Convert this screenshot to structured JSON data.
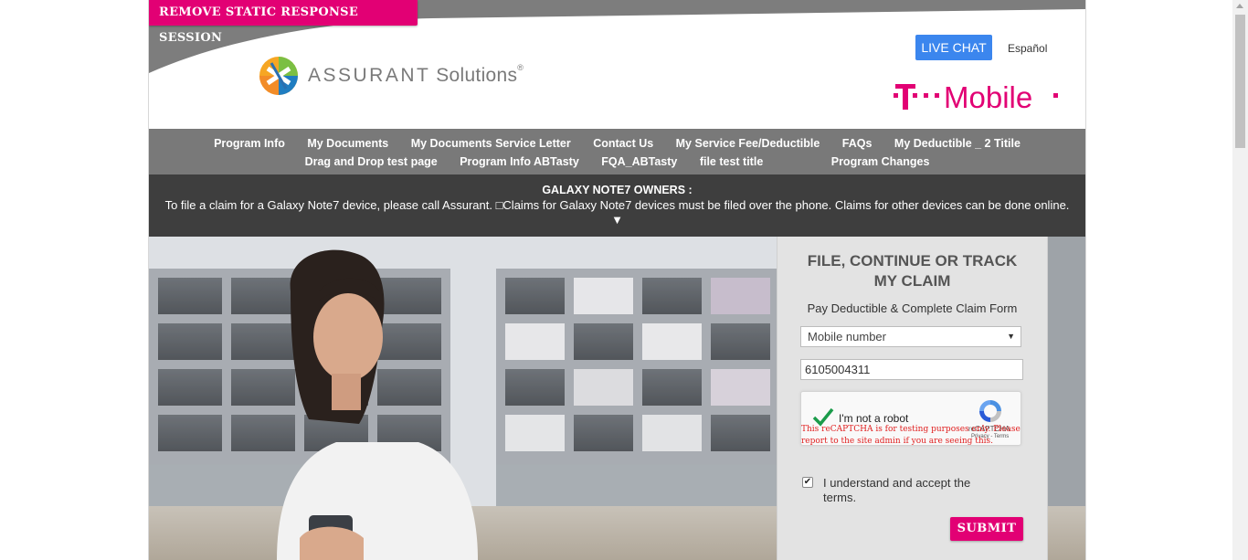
{
  "header": {
    "remove_session_label": "REMOVE STATIC RESPONSE SESSION",
    "logo_brand": "ASSURANT",
    "logo_sub": "Solutions",
    "logo_reg": "®",
    "live_chat_label": "LIVE CHAT",
    "language_link": "Español",
    "carrier_logo": "T-Mobile"
  },
  "nav": {
    "row1": [
      "Program Info",
      "My Documents",
      "My Documents Service Letter",
      "Contact Us",
      "My Service Fee/Deductible",
      "FAQs",
      "My Deductible _ 2 Titile"
    ],
    "row2": [
      "Drag and Drop test page",
      "Program Info ABTasty",
      "FQA_ABTasty",
      "file test title",
      "Program Changes"
    ]
  },
  "alert": {
    "title": "GALAXY NOTE7 OWNERS :",
    "text": "To file a claim for a Galaxy Note7 device, please call Assurant. □Claims for Galaxy Note7 devices must be filed over the phone. Claims for other devices can be done online.",
    "arrow": "▼"
  },
  "claim_form": {
    "title_line1": "FILE, CONTINUE OR TRACK",
    "title_line2": "MY CLAIM",
    "subtitle": "Pay Deductible & Complete Claim Form",
    "lookup_type_selected": "Mobile number",
    "lookup_value": "6105004311",
    "recaptcha": {
      "label": "I'm not a robot",
      "warning": "This reCAPTCHA is for testing purposes only. Please report to the site admin if you are seeing this.",
      "brand": "reCAPTCHA",
      "terms": "Privacy - Terms"
    },
    "terms_label": "I understand and accept the terms.",
    "terms_checked": "✔",
    "submit_label": "SUBMIT"
  },
  "colors": {
    "magenta": "#e20074",
    "nav_gray": "#797979",
    "alert_dark": "#3e3e3e",
    "live_chat_blue": "#3b86ee"
  },
  "icons": [
    "assurant-logo-icon",
    "tmobile-logo-icon",
    "checkmark-icon",
    "recaptcha-icon",
    "dropdown-caret-icon"
  ]
}
